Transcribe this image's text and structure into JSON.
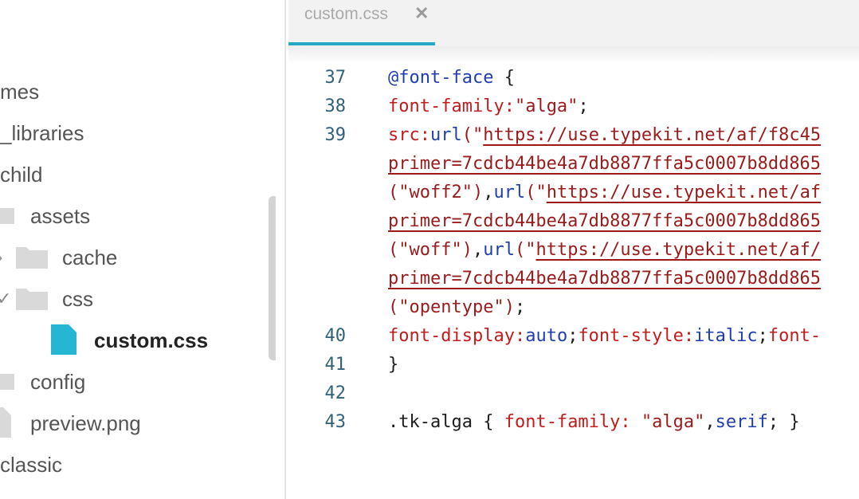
{
  "sidebar": {
    "items": [
      {
        "label": "mes",
        "level": "root"
      },
      {
        "label": "_libraries",
        "level": "root"
      },
      {
        "label": "child",
        "level": "root"
      },
      {
        "label": "assets",
        "level": "folder"
      },
      {
        "label": "cache",
        "level": "subfolder",
        "state": "collapsed"
      },
      {
        "label": "css",
        "level": "subfolder",
        "state": "expanded"
      },
      {
        "label": "custom.css",
        "level": "file",
        "active": true
      },
      {
        "label": "config",
        "level": "folder"
      },
      {
        "label": "preview.png",
        "level": "folder"
      },
      {
        "label": "classic",
        "level": "root"
      }
    ]
  },
  "tabs": [
    {
      "label": "custom.css",
      "close": "✕",
      "active": true
    }
  ],
  "colors": {
    "accent": "#26a9c7",
    "file_icon": "#26b5d3",
    "folder_icon": "#d9d9d9"
  },
  "code": {
    "lines": [
      {
        "num": "37",
        "tokens": [
          [
            "@font-face",
            "kw"
          ],
          [
            " {",
            "pun"
          ]
        ]
      },
      {
        "num": "38",
        "tokens": [
          [
            "font-family",
            "prop"
          ],
          [
            ":",
            "prop"
          ],
          [
            "\"alga\"",
            "str"
          ],
          [
            ";",
            "pun"
          ]
        ]
      },
      {
        "num": "39",
        "tokens": [
          [
            "src",
            "prop"
          ],
          [
            ":",
            "prop"
          ],
          [
            "url",
            "val"
          ],
          [
            "(\"",
            "str"
          ],
          [
            "https://use.typekit.net/af/f8c45",
            "url"
          ]
        ]
      },
      {
        "num": "",
        "tokens": [
          [
            "primer=7cdcb44be4a7db8877ffa5c0007b8dd865",
            "url"
          ]
        ]
      },
      {
        "num": "",
        "tokens": [
          [
            "(\"woff2\")",
            "str"
          ],
          [
            ",",
            "pun"
          ],
          [
            "url",
            "val"
          ],
          [
            "(\"",
            "str"
          ],
          [
            "https://use.typekit.net/af",
            "url"
          ]
        ]
      },
      {
        "num": "",
        "tokens": [
          [
            "primer=7cdcb44be4a7db8877ffa5c0007b8dd865",
            "url"
          ]
        ]
      },
      {
        "num": "",
        "tokens": [
          [
            "(\"woff\")",
            "str"
          ],
          [
            ",",
            "pun"
          ],
          [
            "url",
            "val"
          ],
          [
            "(\"",
            "str"
          ],
          [
            "https://use.typekit.net/af/",
            "url"
          ]
        ]
      },
      {
        "num": "",
        "tokens": [
          [
            "primer=7cdcb44be4a7db8877ffa5c0007b8dd865",
            "url"
          ]
        ]
      },
      {
        "num": "",
        "tokens": [
          [
            "(\"opentype\")",
            "str"
          ],
          [
            ";",
            "pun"
          ]
        ]
      },
      {
        "num": "40",
        "tokens": [
          [
            "font-display",
            "prop"
          ],
          [
            ":",
            "prop"
          ],
          [
            "auto",
            "val"
          ],
          [
            ";",
            "pun"
          ],
          [
            "font-style",
            "prop"
          ],
          [
            ":",
            "prop"
          ],
          [
            "italic",
            "val"
          ],
          [
            ";",
            "pun"
          ],
          [
            "font-",
            "prop"
          ]
        ]
      },
      {
        "num": "41",
        "tokens": [
          [
            "}",
            "pun"
          ]
        ]
      },
      {
        "num": "42",
        "tokens": []
      },
      {
        "num": "43",
        "tokens": [
          [
            ".tk-alga",
            "sel"
          ],
          [
            " { ",
            "pun"
          ],
          [
            "font-family:",
            "prop"
          ],
          [
            " ",
            "pun"
          ],
          [
            "\"alga\"",
            "str"
          ],
          [
            ",",
            "pun"
          ],
          [
            "serif",
            "val"
          ],
          [
            "; }",
            "pun"
          ]
        ]
      }
    ]
  }
}
